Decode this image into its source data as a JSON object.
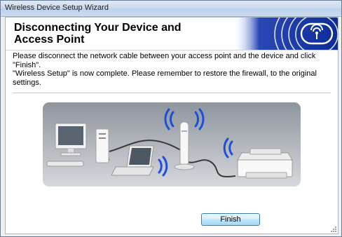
{
  "window": {
    "title": "Wireless Device Setup Wizard"
  },
  "header": {
    "heading": "Disconnecting Your Device and Access Point"
  },
  "body": {
    "line1": "Please disconnect the network cable between your access point and the device and click \"Finish\".",
    "line2": "\"Wireless Setup\" is now complete. Please remember to restore the firewall, to the original settings."
  },
  "buttons": {
    "finish": "Finish"
  },
  "colors": {
    "banner_blue": "#1a3aa6",
    "button_border": "#3c7fb1",
    "wifi_blue": "#1e4fd8"
  },
  "icons": [
    "wireless-logo-icon",
    "desktop-computer-icon",
    "laptop-icon",
    "access-point-icon",
    "printer-icon",
    "wifi-signal-icon"
  ]
}
